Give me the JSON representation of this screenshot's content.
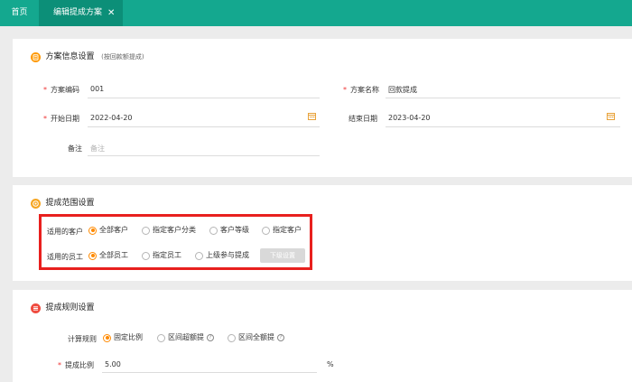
{
  "tabs": {
    "home": "首页",
    "active": "编辑提成方案",
    "close_glyph": "✕"
  },
  "section_info": {
    "title": "方案信息设置",
    "subtitle": "(按回款额提成)",
    "code_label": "方案编码",
    "code_value": "001",
    "name_label": "方案名称",
    "name_value": "回款提成",
    "start_label": "开始日期",
    "start_value": "2022-04-20",
    "end_label": "结束日期",
    "end_value": "2023-04-20",
    "remark_label": "备注",
    "remark_placeholder": "备注"
  },
  "section_scope": {
    "title": "提成范围设置",
    "customer_label": "适用的客户",
    "customer_options": [
      "全部客户",
      "指定客户分类",
      "客户等级",
      "指定客户"
    ],
    "customer_selected": 0,
    "staff_label": "适用的员工",
    "staff_options": [
      "全部员工",
      "指定员工",
      "上级参与提成"
    ],
    "staff_selected": 0,
    "subordinate_button": "下级设置"
  },
  "section_rule": {
    "title": "提成规则设置",
    "calc_label": "计算规则",
    "calc_options": [
      "固定比例",
      "区间超额提",
      "区间全额提"
    ],
    "calc_selected": 0,
    "ratio_label": "提成比例",
    "ratio_value": "5.00",
    "ratio_unit": "%"
  },
  "colors": {
    "topbar": "#14a88f",
    "accent": "#ff8a00",
    "highlight": "#e8201e"
  },
  "icons": {
    "calendar": "calendar-icon",
    "question": "question-circle-icon"
  }
}
